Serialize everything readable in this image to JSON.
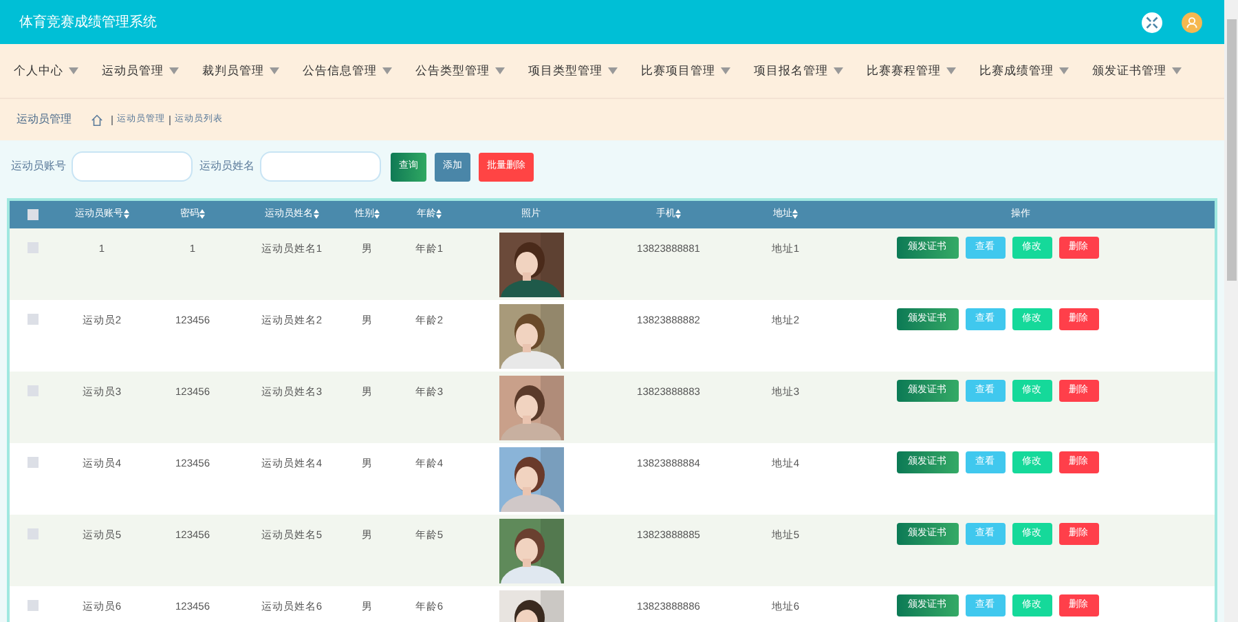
{
  "header": {
    "title": "体育竞赛成绩管理系统"
  },
  "nav": [
    {
      "label": "个人中心"
    },
    {
      "label": "运动员管理"
    },
    {
      "label": "裁判员管理"
    },
    {
      "label": "公告信息管理"
    },
    {
      "label": "公告类型管理"
    },
    {
      "label": "项目类型管理"
    },
    {
      "label": "比赛项目管理"
    },
    {
      "label": "项目报名管理"
    },
    {
      "label": "比赛赛程管理"
    },
    {
      "label": "比赛成绩管理"
    },
    {
      "label": "颁发证书管理"
    }
  ],
  "page_title": "运动员管理",
  "breadcrumb": [
    "运动员管理",
    "运动员列表"
  ],
  "search": {
    "fields": [
      {
        "label": "运动员账号"
      },
      {
        "label": "运动员姓名"
      }
    ],
    "buttons": [
      {
        "label": "查询",
        "kind": "search"
      },
      {
        "label": "添加",
        "kind": "add"
      },
      {
        "label": "批量删除",
        "kind": "delete"
      }
    ]
  },
  "table": {
    "select_all": {
      "checked": false
    },
    "columns": [
      "运动员账号",
      "密码",
      "运动员姓名",
      "性别",
      "年龄",
      "照片",
      "手机",
      "地址",
      "操作"
    ],
    "rows": [
      {
        "checked": false,
        "account": "1",
        "password": "1",
        "name": "运动员姓名1",
        "gender": "男",
        "age": "年龄1",
        "phone": "13823888881",
        "address": "地址1",
        "actions": [
          "颁发证书",
          "查看",
          "修改",
          "删除"
        ]
      },
      {
        "checked": false,
        "account": "运动员2",
        "password": "123456",
        "name": "运动员姓名2",
        "gender": "男",
        "age": "年龄2",
        "phone": "13823888882",
        "address": "地址2",
        "actions": [
          "颁发证书",
          "查看",
          "修改",
          "删除"
        ]
      },
      {
        "checked": false,
        "account": "运动员3",
        "password": "123456",
        "name": "运动员姓名3",
        "gender": "男",
        "age": "年龄3",
        "phone": "13823888883",
        "address": "地址3",
        "actions": [
          "颁发证书",
          "查看",
          "修改",
          "删除"
        ]
      },
      {
        "checked": false,
        "account": "运动员4",
        "password": "123456",
        "name": "运动员姓名4",
        "gender": "男",
        "age": "年龄4",
        "phone": "13823888884",
        "address": "地址4",
        "actions": [
          "颁发证书",
          "查看",
          "修改",
          "删除"
        ]
      },
      {
        "checked": false,
        "account": "运动员5",
        "password": "123456",
        "name": "运动员姓名5",
        "gender": "男",
        "age": "年龄5",
        "phone": "13823888885",
        "address": "地址5",
        "actions": [
          "颁发证书",
          "查看",
          "修改",
          "删除"
        ]
      },
      {
        "checked": false,
        "account": "运动员6",
        "password": "123456",
        "name": "运动员姓名6",
        "gender": "男",
        "age": "年龄6",
        "phone": "13823888886",
        "address": "地址6",
        "actions": [
          "颁发证书",
          "查看",
          "修改",
          "删除"
        ]
      }
    ]
  }
}
